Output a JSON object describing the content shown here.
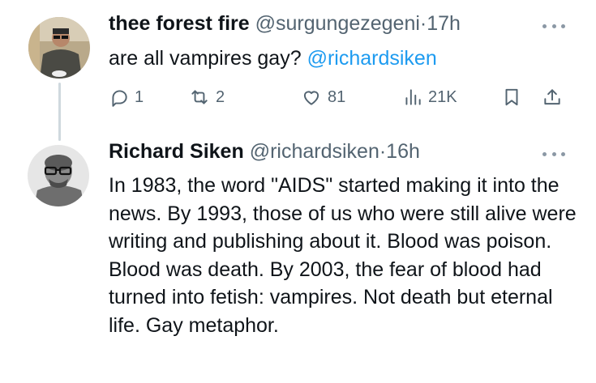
{
  "tweets": [
    {
      "name": "thee forest fire",
      "handle": "@surgungezegeni",
      "separator": "·",
      "time": "17h",
      "text": "are all vampires gay?",
      "mention": "@richardsiken",
      "actions": {
        "replies": "1",
        "retweets": "2",
        "likes": "81",
        "views": "21K"
      }
    },
    {
      "name": "Richard Siken",
      "handle": "@richardsiken",
      "separator": "·",
      "time": "16h",
      "text": "In 1983, the word \"AIDS\" started making it into the news. By 1993, those of us who were still alive were writing and publishing about it. Blood was poison. Blood was death. By 2003, the fear of blood had turned into fetish: vampires. Not death but eternal life. Gay metaphor."
    }
  ],
  "icons": {
    "reply": "reply-icon",
    "retweet": "retweet-icon",
    "like": "heart-icon",
    "views": "views-icon",
    "bookmark": "bookmark-icon",
    "share": "share-icon",
    "more": "more-icon"
  },
  "colors": {
    "text": "#0f1419",
    "secondary": "#536471",
    "link": "#1d9bf0",
    "thread_line": "#cfd9de"
  }
}
